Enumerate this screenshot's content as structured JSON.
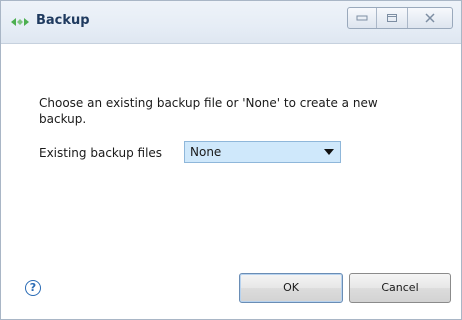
{
  "window": {
    "title": "Backup"
  },
  "dialog": {
    "message": "Choose an existing backup file or 'None' to create a new backup.",
    "field_label": "Existing backup files",
    "select_value": "None"
  },
  "buttons": {
    "help_glyph": "?",
    "ok_label": "OK",
    "cancel_label": "Cancel"
  },
  "icons": {
    "app": "diamond-arrows-icon",
    "minimize": "minimize-icon",
    "maximize": "maximize-icon",
    "close": "close-icon",
    "help": "help-icon",
    "dropdown": "chevron-down-icon"
  },
  "colors": {
    "select_bg": "#cfe8fb",
    "accent": "#2a6bb5",
    "title_text": "#1f3a5f"
  }
}
